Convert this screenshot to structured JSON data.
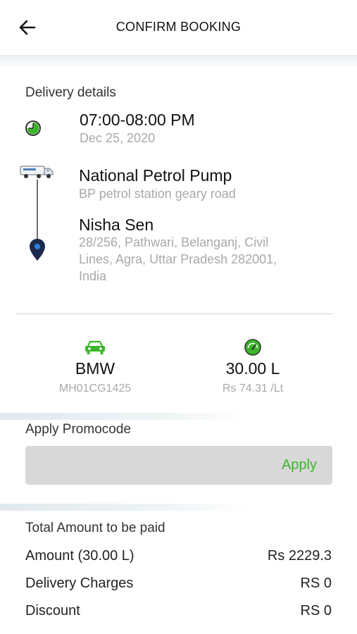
{
  "header": {
    "title": "CONFIRM BOOKING"
  },
  "delivery": {
    "section_label": "Delivery details",
    "time_slot": "07:00-08:00 PM",
    "date": "Dec 25, 2020",
    "pickup_name": "National Petrol Pump",
    "pickup_address": "BP petrol station geary road",
    "drop_name": "Nisha Sen",
    "drop_address_lines": [
      "28/256, Pathwari, Belanganj, Civil",
      "Lines, Agra, Uttar Pradesh 282001,",
      "India"
    ]
  },
  "vehicle": {
    "name": "BMW",
    "plate": "MH01CG1425"
  },
  "fuel": {
    "quantity": "30.00 L",
    "rate": "Rs 74.31 /Lt"
  },
  "promo": {
    "label": "Apply Promocode",
    "apply_label": "Apply"
  },
  "summary": {
    "title": "Total Amount to be paid",
    "rows": [
      {
        "label": "Amount (30.00 L)",
        "value": "Rs 2229.3"
      },
      {
        "label": "Delivery Charges",
        "value": "RS 0"
      },
      {
        "label": "Discount",
        "value": "RS 0"
      }
    ]
  },
  "colors": {
    "accent_green": "#3cb52b",
    "pin_navy": "#1d2a4d",
    "pin_blue": "#2f7fe0"
  },
  "icons": [
    "back-arrow-icon",
    "clock-icon",
    "fuel-truck-icon",
    "location-pin-icon",
    "car-icon",
    "fuel-gauge-icon"
  ]
}
